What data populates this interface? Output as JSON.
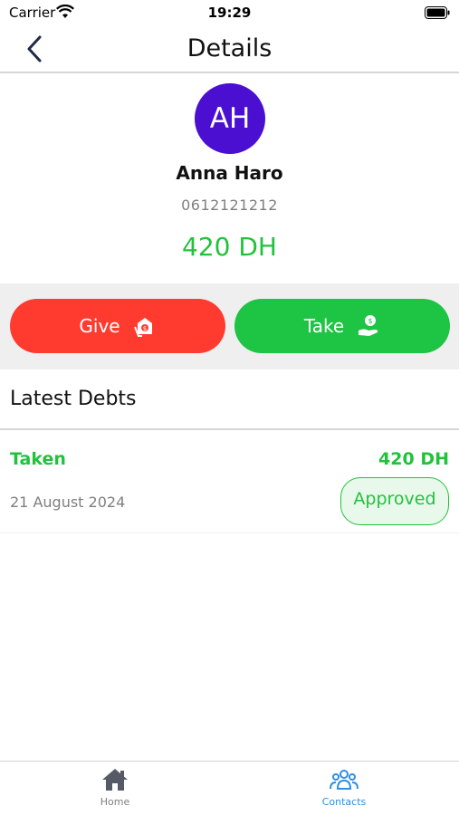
{
  "status_bar": {
    "carrier": "Carrier",
    "time": "19:29"
  },
  "nav": {
    "title": "Details"
  },
  "contact": {
    "initials": "AH",
    "name": "Anna Haro",
    "phone": "0612121212",
    "balance": "420 DH"
  },
  "actions": {
    "give_label": "Give",
    "take_label": "Take"
  },
  "debts": {
    "section_title": "Latest Debts",
    "items": [
      {
        "type": "Taken",
        "amount": "420 DH",
        "date": "21 August 2024",
        "status": "Approved"
      }
    ]
  },
  "tabbar": {
    "items": [
      {
        "label": "Home",
        "icon": "home-icon"
      },
      {
        "label": "Contacts",
        "icon": "contacts-icon"
      }
    ]
  },
  "colors": {
    "avatar": "#4a0fd0",
    "give": "#ff3b30",
    "take": "#1ec444",
    "positive": "#22c23c",
    "active_tab": "#2f8fe0"
  }
}
